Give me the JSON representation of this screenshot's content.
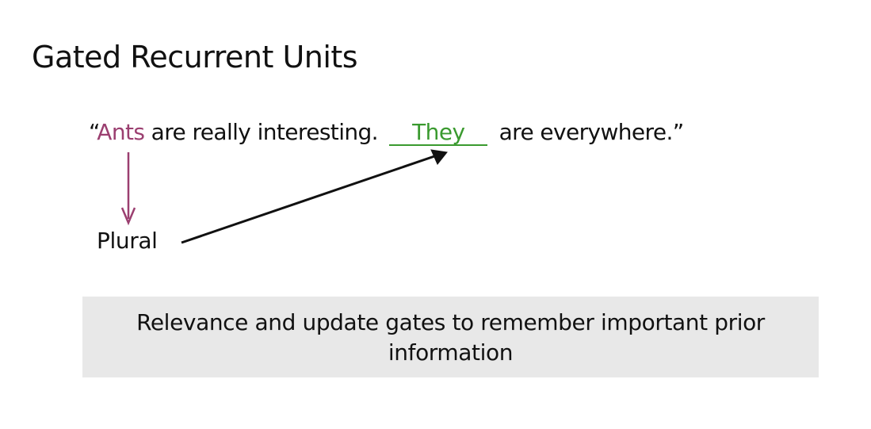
{
  "title": "Gated Recurrent Units",
  "sentence": {
    "open_quote": "“",
    "subject": "Ants",
    "middle": " are really interesting. ",
    "blank_word": "They",
    "end": " are everywhere.”"
  },
  "annotation": {
    "label": "Plural"
  },
  "callout": {
    "line1": "Relevance and update gates to remember important prior",
    "line2": "information"
  },
  "colors": {
    "subject": "#9b3f70",
    "blank_word": "#3a9a2f",
    "arrow_down": "#9b3f70",
    "arrow_diagonal": "#111111",
    "callout_background": "#e8e8e8"
  }
}
